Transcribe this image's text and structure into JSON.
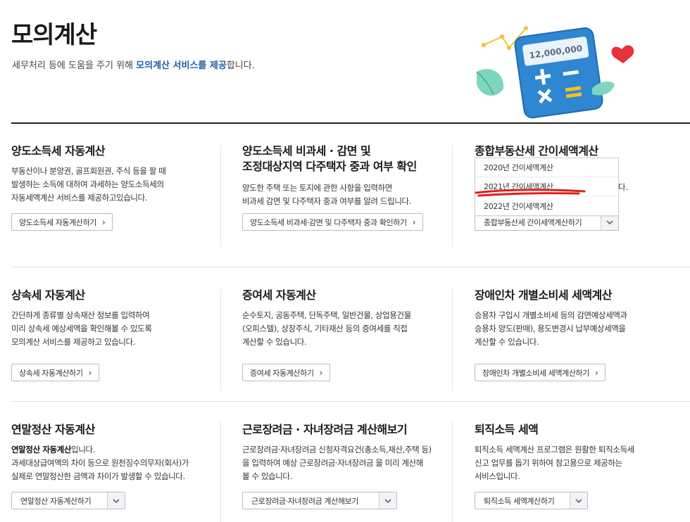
{
  "header": {
    "title": "모의계산",
    "desc_pre": "세무처리 등에 도움을 주기 위해 ",
    "desc_highlight": "모의계산 서비스를 제공",
    "desc_post": "합니다."
  },
  "hero": {
    "amount": "12,000,000"
  },
  "cards": [
    {
      "title": "양도소득세 자동계산",
      "desc": [
        "부동산이나 분양권, 골프회원권, 주식 등을 팔 때",
        "발생하는 소득에 대하여 과세하는 양도소득세의",
        "자동세액계산 서비스를 제공하고있습니다."
      ],
      "button": "양도소득세 자동계산하기"
    },
    {
      "title_lines": [
        "양도소득세 비과세 · 감면 및",
        "조정대상지역 다주택자 중과 여부 확인"
      ],
      "desc": [
        "양도한 주택 또는 토지에 관한 사항을 입력하면",
        "비과세 감면 및 다주택자 중과 여부를 알려 드립니다."
      ],
      "button": "양도소득세 비과세·감면 및 다주택자 중과 확인하기"
    },
    {
      "title": "종합부동산세 간이세액계산",
      "desc_tail": "다.",
      "combo": "종합부동산세 간이세액계산하기",
      "options": [
        "2020년 간이세액계산",
        "2021년 간이세액계산",
        "2022년 간이세액계산"
      ]
    },
    {
      "title": "상속세 자동계산",
      "desc": [
        "간단하게 종류별 상속재산 정보를 입력하여",
        "미리 상속세 예상세액을 확인해볼 수 있도록",
        "모의계산 서비스를 제공하고 있습니다."
      ],
      "button": "상속세 자동계산하기"
    },
    {
      "title": "증여세 자동계산",
      "desc": [
        "순수토지, 공동주택, 단독주택, 일반건물, 상업용건물",
        "(오피스텔), 상장주식, 기타재산 등의 증여세를 직접",
        "계산할 수 있습니다."
      ],
      "button": "증여세 자동계산하기"
    },
    {
      "title": "장애인차 개별소비세 세액계산",
      "desc": [
        "승용차 구입시 개별소비세 등의 감면예상세액과",
        "승용차 양도(판매), 용도변경시 납부예상세액을",
        "계산할 수 있습니다."
      ],
      "button": "장애인차 개별소비세 세액계산하기"
    },
    {
      "title": "연말정산 자동계산",
      "desc_bold": "연말정산 자동계산",
      "desc_bold_tail": "입니다.",
      "desc": [
        "과세대상급여액의 차이 등으로 원천징수의무자(회사)가",
        "실제로 연말정산한 금액과 차이가 발생할 수 있습니다."
      ],
      "combo": "연말정산 자동계산하기"
    },
    {
      "title": "근로장려금 · 자녀장려금 계산해보기",
      "desc": [
        "근로장려금·자녀장려금 신청자격요건(총소득,재산,주택 등)",
        "을 입력하여 예상 근로장려금·자녀장려금 을 미리 계산해",
        "볼 수 있습니다."
      ],
      "combo": "근로장려금·자녀장려금 계산해보기"
    },
    {
      "title": "퇴직소득 세액",
      "desc": [
        "퇴직소득 세액계산 프로그램은 원활한 퇴직소득세",
        "신고 업무를 돕기 위하여 참고용으로 제공하는",
        "서비스입니다."
      ],
      "combo": "퇴직소득 세액계산하기"
    }
  ],
  "colors": {
    "accent": "#1b5fa8",
    "annotation": "#e0201b"
  },
  "icons": {
    "link_chevron": "›",
    "dropdown": "chevron-down"
  }
}
